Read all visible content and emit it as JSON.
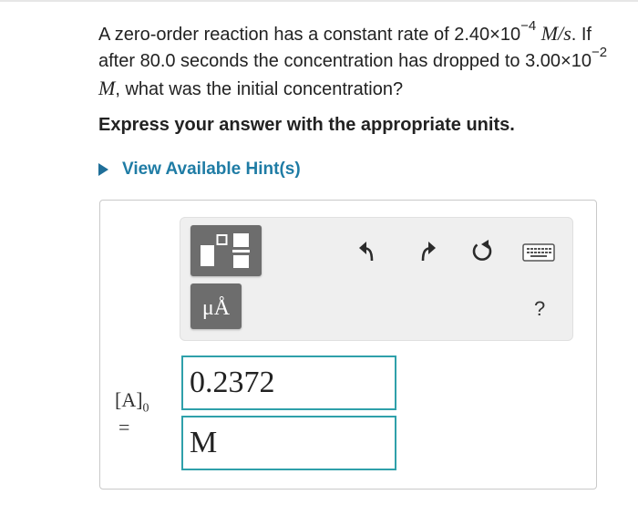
{
  "question": {
    "p1": "A zero-order reaction has a constant rate of 2.40×10",
    "p1_exp": "−4",
    "p2_unit": "M/s",
    "p3": ". If after 80.0 seconds the concentration has dropped to 3.00×10",
    "p3_exp": "−2",
    "p4_unit": "M",
    "p5": ", what was the initial concentration?"
  },
  "instruction": "Express your answer with the appropriate units.",
  "hint_link": "View Available Hint(s)",
  "toolbar": {
    "unit_button": "μÅ",
    "help": "?",
    "icons": [
      "templates-icon",
      "units-icon",
      "undo-icon",
      "redo-icon",
      "reset-icon",
      "keyboard-icon",
      "help-icon"
    ]
  },
  "answer": {
    "label": "[A]",
    "label_sub": "0",
    "equals": "=",
    "value": "0.2372",
    "unit": "M"
  },
  "colors": {
    "link": "#1f7ca5",
    "field_border": "#2fa0aa",
    "button_bg": "#6d6d6d",
    "toolbar_bg": "#efefef"
  }
}
